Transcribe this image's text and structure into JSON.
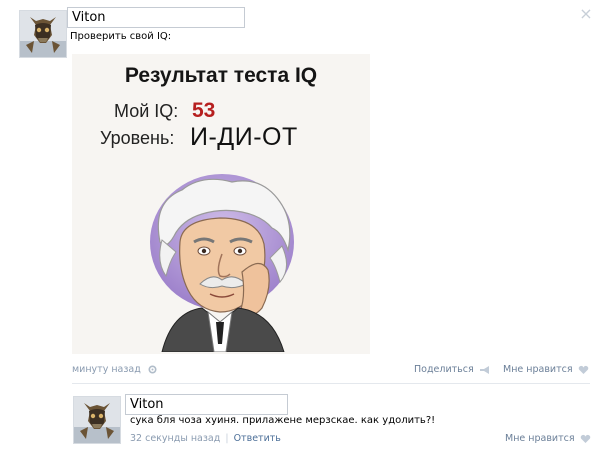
{
  "post": {
    "author": "Viton",
    "text": "Проверить свой IQ:",
    "image": {
      "title": "Результат теста IQ",
      "iq_label": "Мой IQ:",
      "iq_value": "53",
      "level_label": "Уровень:",
      "level_value": "И-ДИ-ОТ"
    },
    "time": "минуту назад",
    "share_label": "Поделиться",
    "like_label": "Мне нравится"
  },
  "comment": {
    "author": "Viton",
    "text": "сука бля чоза хуиня. прилажене мерзскае. как удолить?!",
    "time": "32 секунды назад",
    "separator": "|",
    "reply_label": "Ответить",
    "like_label": "Мне нравится"
  },
  "colors": {
    "link": "#4c6f98",
    "meta": "#8a9bb0",
    "iq_value": "#b61f1f"
  }
}
